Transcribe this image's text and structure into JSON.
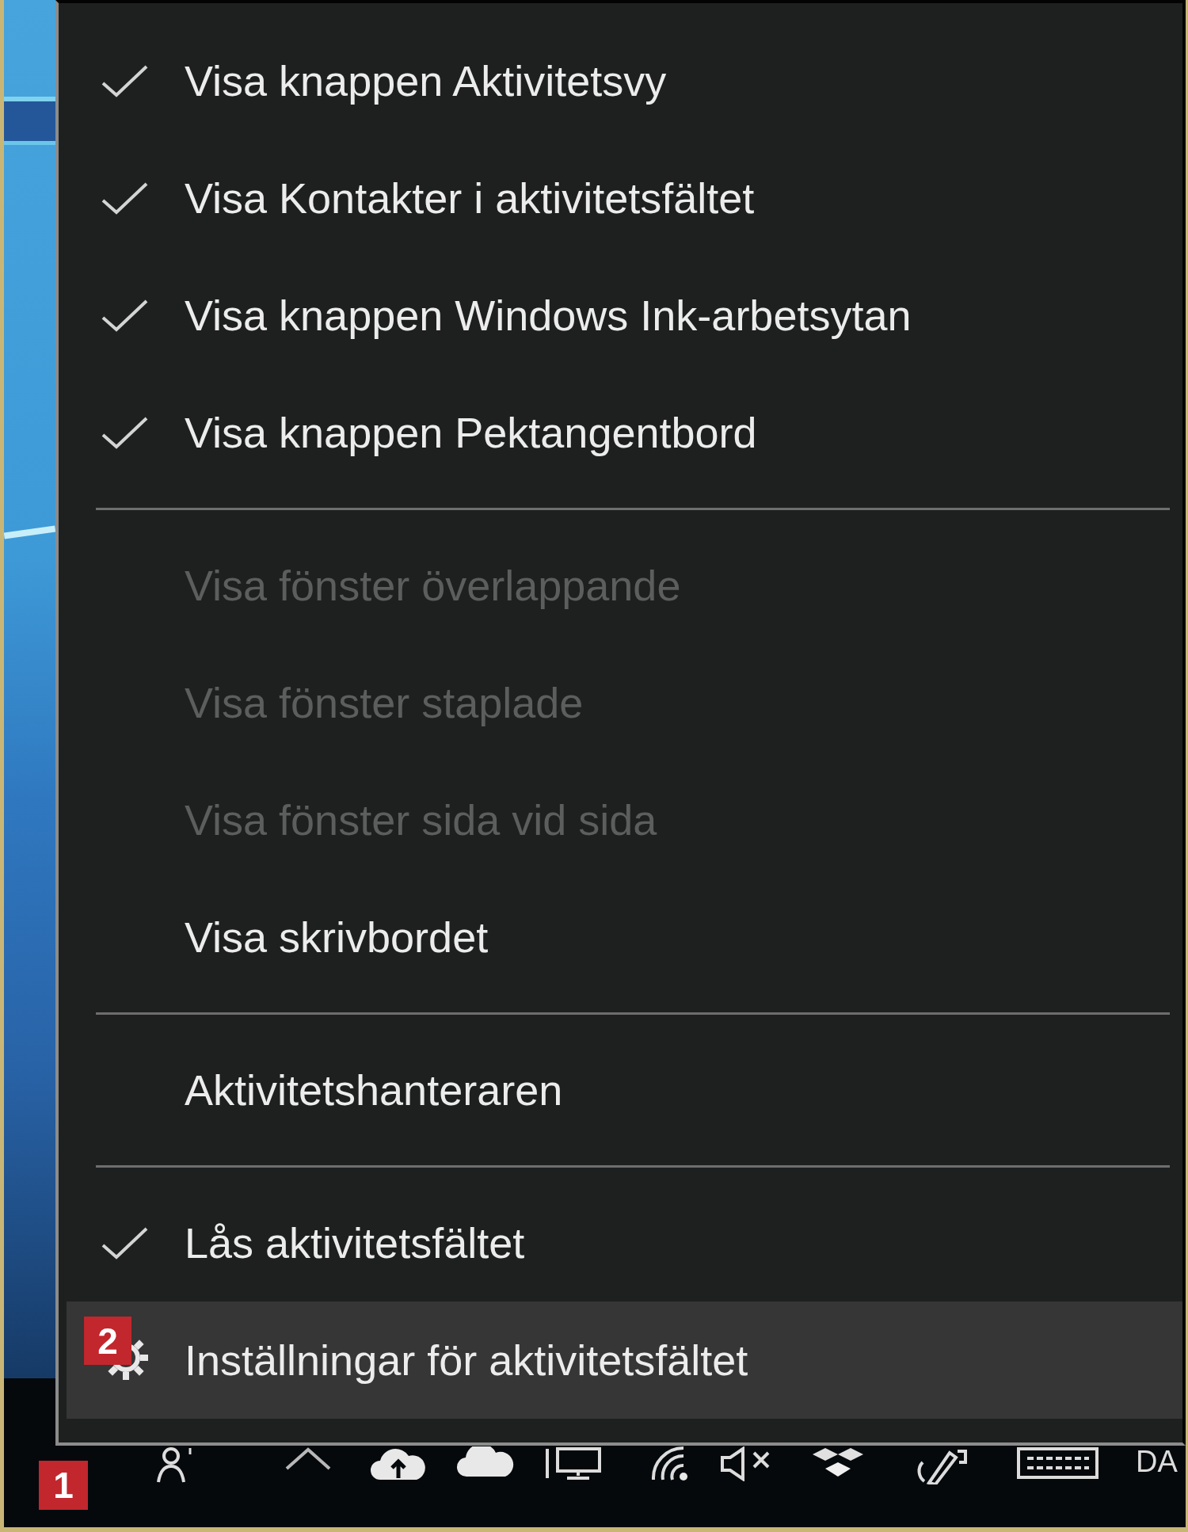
{
  "menu": {
    "groups": [
      {
        "items": [
          {
            "kind": "command",
            "label": "Visa knappen Aktivitetsvy",
            "checked": true,
            "disabled": false,
            "highlighted": false
          },
          {
            "kind": "command",
            "label": "Visa Kontakter i aktivitetsfältet",
            "checked": true,
            "disabled": false,
            "highlighted": false
          },
          {
            "kind": "command",
            "label": "Visa knappen Windows Ink-arbetsytan",
            "checked": true,
            "disabled": false,
            "highlighted": false
          },
          {
            "kind": "command",
            "label": "Visa knappen Pektangentbord",
            "checked": true,
            "disabled": false,
            "highlighted": false
          }
        ]
      },
      {
        "items": [
          {
            "kind": "command",
            "label": "Visa fönster överlappande",
            "checked": false,
            "disabled": true,
            "highlighted": false
          },
          {
            "kind": "command",
            "label": "Visa fönster staplade",
            "checked": false,
            "disabled": true,
            "highlighted": false
          },
          {
            "kind": "command",
            "label": "Visa fönster sida vid sida",
            "checked": false,
            "disabled": true,
            "highlighted": false
          },
          {
            "kind": "command",
            "label": "Visa skrivbordet",
            "checked": false,
            "disabled": false,
            "highlighted": false
          }
        ]
      },
      {
        "items": [
          {
            "kind": "command",
            "label": "Aktivitetshanteraren",
            "checked": false,
            "disabled": false,
            "highlighted": false
          }
        ]
      },
      {
        "items": [
          {
            "kind": "command",
            "label": "Lås aktivitetsfältet",
            "checked": true,
            "disabled": false,
            "highlighted": false
          },
          {
            "kind": "settings",
            "label": "Inställningar för aktivitetsfältet",
            "checked": false,
            "disabled": false,
            "highlighted": true,
            "callout": "2"
          }
        ]
      }
    ]
  },
  "taskbar": {
    "callout": "1",
    "tray_text": "DA"
  }
}
